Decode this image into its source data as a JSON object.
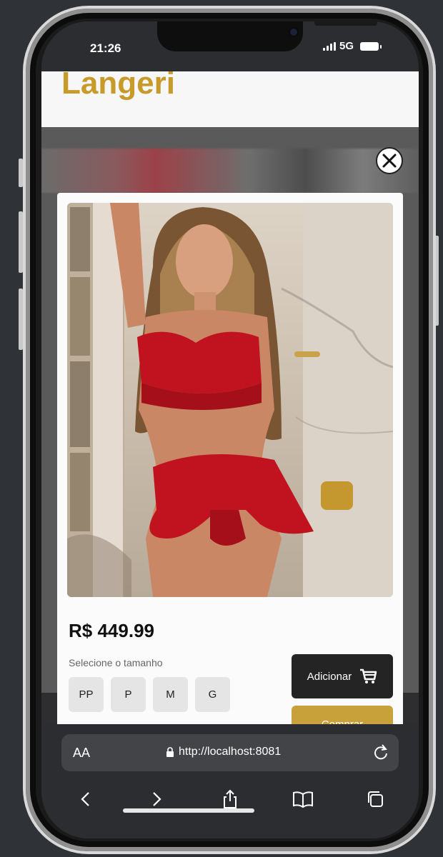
{
  "status_bar": {
    "time": "21:26",
    "network": "5G"
  },
  "header": {
    "brand": "Langeri"
  },
  "modal": {
    "price": "R$ 449.99",
    "size_label": "Selecione o tamanho",
    "sizes": [
      "PP",
      "P",
      "M",
      "G"
    ],
    "add_label": "Adicionar",
    "buy_label": "Comprar"
  },
  "browser": {
    "aa_label": "AA",
    "url": "http://localhost:8081"
  },
  "icons": {
    "close": "close-icon",
    "cart": "cart-icon",
    "lock": "lock-icon",
    "reload": "reload-icon",
    "back": "chevron-left-icon",
    "forward": "chevron-right-icon",
    "share": "share-icon",
    "bookmarks": "book-icon",
    "tabs": "tabs-icon"
  },
  "colors": {
    "brand": "#c79a2a",
    "add_button": "#242424",
    "buy_button": "#c9a13a"
  }
}
